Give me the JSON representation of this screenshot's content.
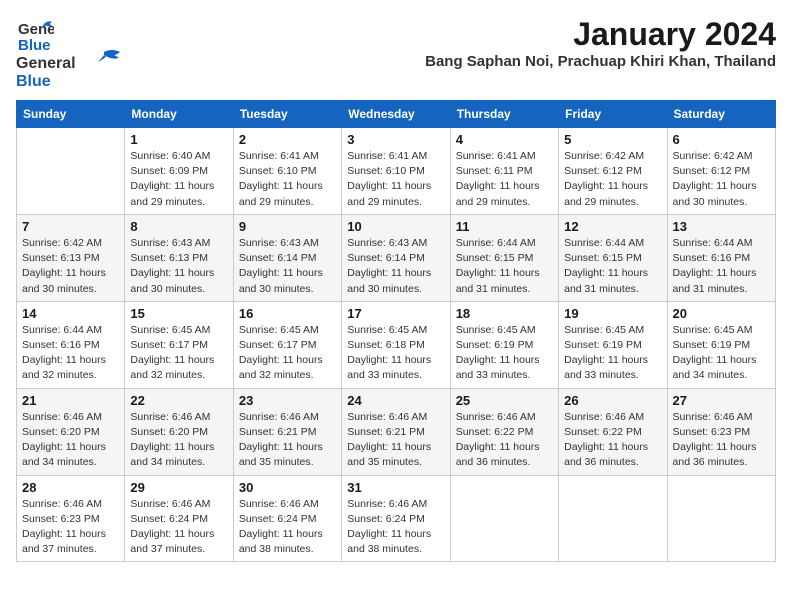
{
  "header": {
    "logo_line1": "General",
    "logo_line2": "Blue",
    "month": "January 2024",
    "location": "Bang Saphan Noi, Prachuap Khiri Khan, Thailand"
  },
  "weekdays": [
    "Sunday",
    "Monday",
    "Tuesday",
    "Wednesday",
    "Thursday",
    "Friday",
    "Saturday"
  ],
  "weeks": [
    [
      {
        "day": "",
        "info": ""
      },
      {
        "day": "1",
        "info": "Sunrise: 6:40 AM\nSunset: 6:09 PM\nDaylight: 11 hours\nand 29 minutes."
      },
      {
        "day": "2",
        "info": "Sunrise: 6:41 AM\nSunset: 6:10 PM\nDaylight: 11 hours\nand 29 minutes."
      },
      {
        "day": "3",
        "info": "Sunrise: 6:41 AM\nSunset: 6:10 PM\nDaylight: 11 hours\nand 29 minutes."
      },
      {
        "day": "4",
        "info": "Sunrise: 6:41 AM\nSunset: 6:11 PM\nDaylight: 11 hours\nand 29 minutes."
      },
      {
        "day": "5",
        "info": "Sunrise: 6:42 AM\nSunset: 6:12 PM\nDaylight: 11 hours\nand 29 minutes."
      },
      {
        "day": "6",
        "info": "Sunrise: 6:42 AM\nSunset: 6:12 PM\nDaylight: 11 hours\nand 30 minutes."
      }
    ],
    [
      {
        "day": "7",
        "info": "Sunrise: 6:42 AM\nSunset: 6:13 PM\nDaylight: 11 hours\nand 30 minutes."
      },
      {
        "day": "8",
        "info": "Sunrise: 6:43 AM\nSunset: 6:13 PM\nDaylight: 11 hours\nand 30 minutes."
      },
      {
        "day": "9",
        "info": "Sunrise: 6:43 AM\nSunset: 6:14 PM\nDaylight: 11 hours\nand 30 minutes."
      },
      {
        "day": "10",
        "info": "Sunrise: 6:43 AM\nSunset: 6:14 PM\nDaylight: 11 hours\nand 30 minutes."
      },
      {
        "day": "11",
        "info": "Sunrise: 6:44 AM\nSunset: 6:15 PM\nDaylight: 11 hours\nand 31 minutes."
      },
      {
        "day": "12",
        "info": "Sunrise: 6:44 AM\nSunset: 6:15 PM\nDaylight: 11 hours\nand 31 minutes."
      },
      {
        "day": "13",
        "info": "Sunrise: 6:44 AM\nSunset: 6:16 PM\nDaylight: 11 hours\nand 31 minutes."
      }
    ],
    [
      {
        "day": "14",
        "info": "Sunrise: 6:44 AM\nSunset: 6:16 PM\nDaylight: 11 hours\nand 32 minutes."
      },
      {
        "day": "15",
        "info": "Sunrise: 6:45 AM\nSunset: 6:17 PM\nDaylight: 11 hours\nand 32 minutes."
      },
      {
        "day": "16",
        "info": "Sunrise: 6:45 AM\nSunset: 6:17 PM\nDaylight: 11 hours\nand 32 minutes."
      },
      {
        "day": "17",
        "info": "Sunrise: 6:45 AM\nSunset: 6:18 PM\nDaylight: 11 hours\nand 33 minutes."
      },
      {
        "day": "18",
        "info": "Sunrise: 6:45 AM\nSunset: 6:19 PM\nDaylight: 11 hours\nand 33 minutes."
      },
      {
        "day": "19",
        "info": "Sunrise: 6:45 AM\nSunset: 6:19 PM\nDaylight: 11 hours\nand 33 minutes."
      },
      {
        "day": "20",
        "info": "Sunrise: 6:45 AM\nSunset: 6:19 PM\nDaylight: 11 hours\nand 34 minutes."
      }
    ],
    [
      {
        "day": "21",
        "info": "Sunrise: 6:46 AM\nSunset: 6:20 PM\nDaylight: 11 hours\nand 34 minutes."
      },
      {
        "day": "22",
        "info": "Sunrise: 6:46 AM\nSunset: 6:20 PM\nDaylight: 11 hours\nand 34 minutes."
      },
      {
        "day": "23",
        "info": "Sunrise: 6:46 AM\nSunset: 6:21 PM\nDaylight: 11 hours\nand 35 minutes."
      },
      {
        "day": "24",
        "info": "Sunrise: 6:46 AM\nSunset: 6:21 PM\nDaylight: 11 hours\nand 35 minutes."
      },
      {
        "day": "25",
        "info": "Sunrise: 6:46 AM\nSunset: 6:22 PM\nDaylight: 11 hours\nand 36 minutes."
      },
      {
        "day": "26",
        "info": "Sunrise: 6:46 AM\nSunset: 6:22 PM\nDaylight: 11 hours\nand 36 minutes."
      },
      {
        "day": "27",
        "info": "Sunrise: 6:46 AM\nSunset: 6:23 PM\nDaylight: 11 hours\nand 36 minutes."
      }
    ],
    [
      {
        "day": "28",
        "info": "Sunrise: 6:46 AM\nSunset: 6:23 PM\nDaylight: 11 hours\nand 37 minutes."
      },
      {
        "day": "29",
        "info": "Sunrise: 6:46 AM\nSunset: 6:24 PM\nDaylight: 11 hours\nand 37 minutes."
      },
      {
        "day": "30",
        "info": "Sunrise: 6:46 AM\nSunset: 6:24 PM\nDaylight: 11 hours\nand 38 minutes."
      },
      {
        "day": "31",
        "info": "Sunrise: 6:46 AM\nSunset: 6:24 PM\nDaylight: 11 hours\nand 38 minutes."
      },
      {
        "day": "",
        "info": ""
      },
      {
        "day": "",
        "info": ""
      },
      {
        "day": "",
        "info": ""
      }
    ]
  ]
}
